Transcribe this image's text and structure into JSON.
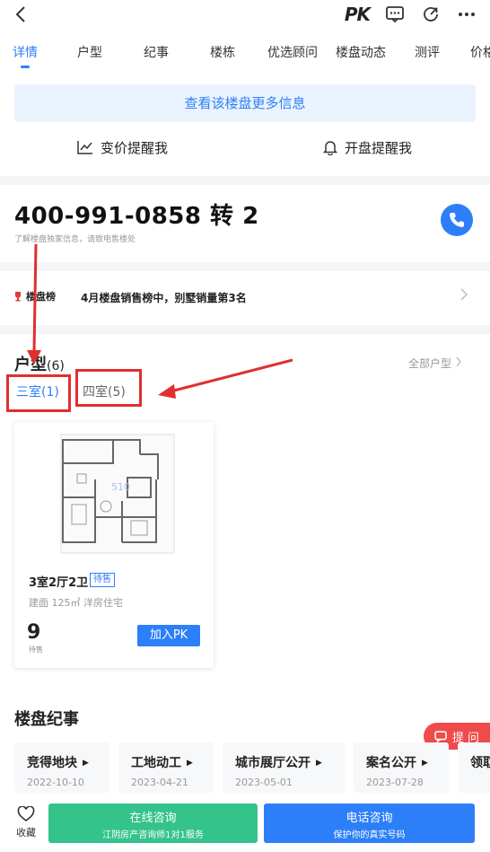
{
  "header": {
    "back_icon": "back-chevron-icon",
    "pk_label": "PK",
    "icons": [
      "message-icon",
      "share-icon",
      "more-dots-icon"
    ]
  },
  "tabs": [
    {
      "label": "详情",
      "active": true
    },
    {
      "label": "户型"
    },
    {
      "label": "纪事"
    },
    {
      "label": "楼栋"
    },
    {
      "label": "优选顾问"
    },
    {
      "label": "楼盘动态"
    },
    {
      "label": "测评"
    },
    {
      "label": "价格"
    }
  ],
  "more_info_label": "查看该楼盘更多信息",
  "remind": {
    "price_label": "变价提醒我",
    "open_label": "开盘提醒我"
  },
  "phone": {
    "number": "400-991-0858 转 2",
    "subtitle": "了解楼盘独家信息，请致电售楼处"
  },
  "rank": {
    "badge_label": "楼盘榜",
    "text": "4月楼盘销售榜中，别墅销量第3名"
  },
  "house_types": {
    "title": "户型",
    "count": "(6)",
    "all_label": "全部户型",
    "tabs": [
      {
        "label": "三室(1)",
        "active": true
      },
      {
        "label": "四室(5)"
      }
    ],
    "card": {
      "title": "3室2厅2卫",
      "tag": "待售",
      "meta": "建面 125㎡    洋房住宅",
      "price": "9",
      "price_label": "待售",
      "pk_button": "加入PK"
    }
  },
  "events": {
    "title": "楼盘纪事",
    "items": [
      {
        "name": "竞得地块",
        "date": "2022-10-10"
      },
      {
        "name": "工地动工",
        "date": "2023-04-21"
      },
      {
        "name": "城市展厅公开",
        "date": "2023-05-01"
      },
      {
        "name": "案名公开",
        "date": "2023-07-28"
      },
      {
        "name": "领取",
        "date": ""
      }
    ]
  },
  "ask_button": "提 问",
  "bottom": {
    "fav_label": "收藏",
    "online_main": "在线咨询",
    "online_sub": "江阴房产咨询师1对1服务",
    "phone_main": "电话咨询",
    "phone_sub": "保护你的真实号码"
  },
  "colors": {
    "accent": "#2d7ff9",
    "green": "#35c38c",
    "red": "#e02f2f"
  }
}
